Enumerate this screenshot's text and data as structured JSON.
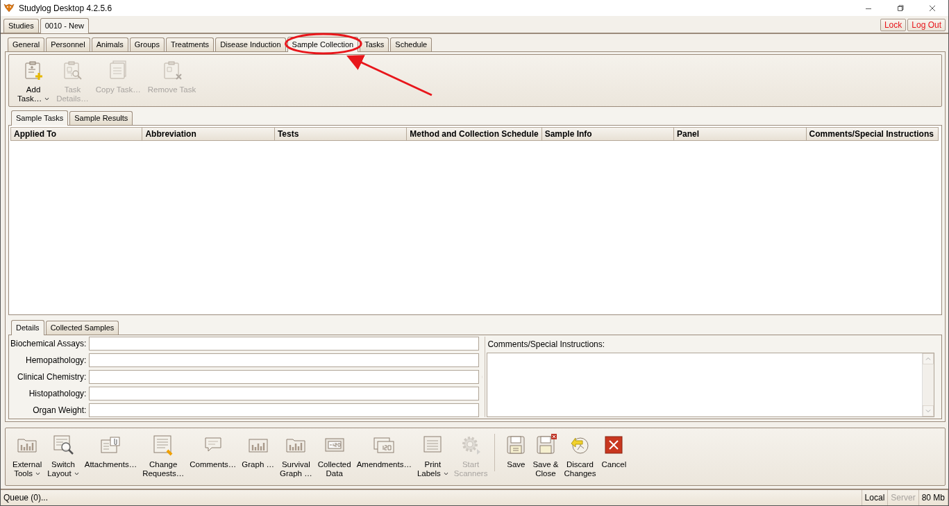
{
  "window": {
    "title": "Studylog Desktop 4.2.5.6"
  },
  "study_tabs": [
    {
      "label": "Studies",
      "selected": false
    },
    {
      "label": "0010 - New",
      "selected": true
    }
  ],
  "header_buttons": [
    "Lock",
    "Log Out"
  ],
  "main_tabs": [
    {
      "label": "General",
      "selected": false
    },
    {
      "label": "Personnel",
      "selected": false
    },
    {
      "label": "Animals",
      "selected": false
    },
    {
      "label": "Groups",
      "selected": false
    },
    {
      "label": "Treatments",
      "selected": false
    },
    {
      "label": "Disease Induction",
      "selected": false
    },
    {
      "label": "Sample Collection",
      "selected": true
    },
    {
      "label": "Tasks",
      "selected": false
    },
    {
      "label": "Schedule",
      "selected": false
    }
  ],
  "task_toolbar": [
    {
      "label": "Add\nTask…",
      "disabled": false,
      "dropdown": true
    },
    {
      "label": "Task\nDetails…",
      "disabled": true,
      "dropdown": false
    },
    {
      "label": "Copy Task…",
      "disabled": true,
      "dropdown": false
    },
    {
      "label": "Remove Task",
      "disabled": true,
      "dropdown": false
    }
  ],
  "sample_tabs": [
    {
      "label": "Sample Tasks",
      "selected": true
    },
    {
      "label": "Sample Results",
      "selected": false
    }
  ],
  "table": {
    "columns": [
      "Applied To",
      "Abbreviation",
      "Tests",
      "Method and Collection Schedule",
      "Sample Info",
      "Panel",
      "Comments/Special Instructions"
    ]
  },
  "detail_tabs": [
    {
      "label": "Details",
      "selected": true
    },
    {
      "label": "Collected Samples",
      "selected": false
    }
  ],
  "detail_fields": [
    {
      "label": "Biochemical Assays:"
    },
    {
      "label": "Hemopathology:"
    },
    {
      "label": "Clinical Chemistry:"
    },
    {
      "label": "Histopathology:"
    },
    {
      "label": "Organ Weight:"
    }
  ],
  "comments": {
    "label": "Comments/Special Instructions:"
  },
  "bottom_toolbar": {
    "left": [
      {
        "label": "External\nTools",
        "disabled": false,
        "dropdown": true
      },
      {
        "label": "Switch\nLayout",
        "disabled": false,
        "dropdown": true
      },
      {
        "label": "Attachments…",
        "disabled": false,
        "dropdown": false
      },
      {
        "label": "Change\nRequests…",
        "disabled": false,
        "dropdown": false
      },
      {
        "label": "Comments…",
        "disabled": false,
        "dropdown": false
      },
      {
        "label": "Graph …",
        "disabled": false,
        "dropdown": false
      },
      {
        "label": "Survival\nGraph …",
        "disabled": false,
        "dropdown": false
      },
      {
        "label": "Collected\nData",
        "disabled": false,
        "dropdown": false
      },
      {
        "label": "Amendments…",
        "disabled": false,
        "dropdown": false
      },
      {
        "label": "Print\nLabels",
        "disabled": false,
        "dropdown": true
      },
      {
        "label": "Start\nScanners",
        "disabled": true,
        "dropdown": false
      }
    ],
    "right": [
      {
        "label": "Save",
        "disabled": false,
        "dropdown": false
      },
      {
        "label": "Save &\nClose",
        "disabled": false,
        "dropdown": false
      },
      {
        "label": "Discard\nChanges",
        "disabled": false,
        "dropdown": false
      },
      {
        "label": "Cancel",
        "disabled": false,
        "dropdown": false
      }
    ]
  },
  "status_bar": {
    "queue": "Queue (0)...",
    "items": [
      {
        "label": "Local",
        "disabled": false
      },
      {
        "label": "Server",
        "disabled": true
      },
      {
        "label": "80 Mb",
        "disabled": false
      }
    ]
  }
}
